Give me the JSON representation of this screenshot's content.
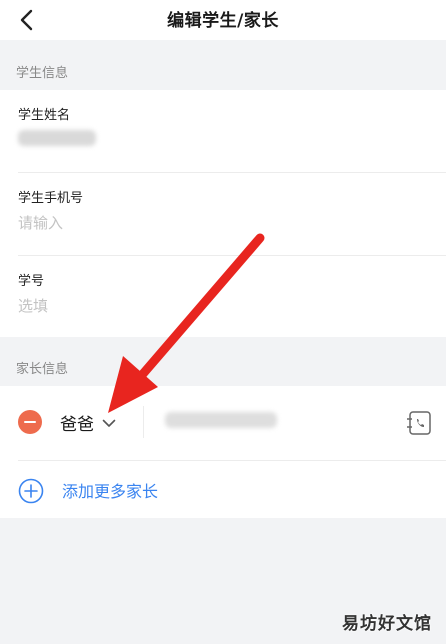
{
  "header": {
    "title": "编辑学生/家长"
  },
  "student_section": {
    "title": "学生信息",
    "fields": [
      {
        "label": "学生姓名",
        "value": "",
        "placeholder": ""
      },
      {
        "label": "学生手机号",
        "value": "",
        "placeholder": "请输入"
      },
      {
        "label": "学号",
        "value": "",
        "placeholder": "选填"
      }
    ]
  },
  "parent_section": {
    "title": "家长信息",
    "parents": [
      {
        "relation": "爸爸"
      }
    ],
    "add_more_label": "添加更多家长"
  },
  "annotation": {
    "arrow_color": "#e8251f"
  },
  "watermark": {
    "text": "易坊好文馆"
  },
  "colors": {
    "accent": "#3a84f0",
    "danger": "#ee6b4d",
    "background": "#f2f3f5"
  }
}
